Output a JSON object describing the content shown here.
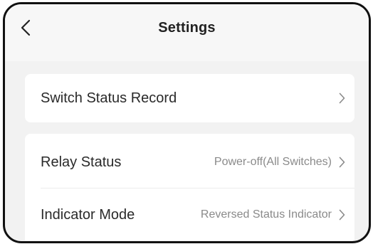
{
  "header": {
    "title": "Settings",
    "back_icon": "chevron-left-icon"
  },
  "settings": {
    "switch_status_record": {
      "label": "Switch Status Record",
      "icon": "chevron-right-icon"
    },
    "relay_status": {
      "label": "Relay Status",
      "value": "Power-off(All Switches)",
      "icon": "chevron-right-icon"
    },
    "indicator_mode": {
      "label": "Indicator Mode",
      "value": "Reversed Status Indicator",
      "icon": "chevron-right-icon"
    }
  },
  "colors": {
    "page_background": "#f2f2f2",
    "card_background": "#ffffff",
    "primary_text": "#2a2a2a",
    "secondary_text": "#8a8a8a"
  }
}
